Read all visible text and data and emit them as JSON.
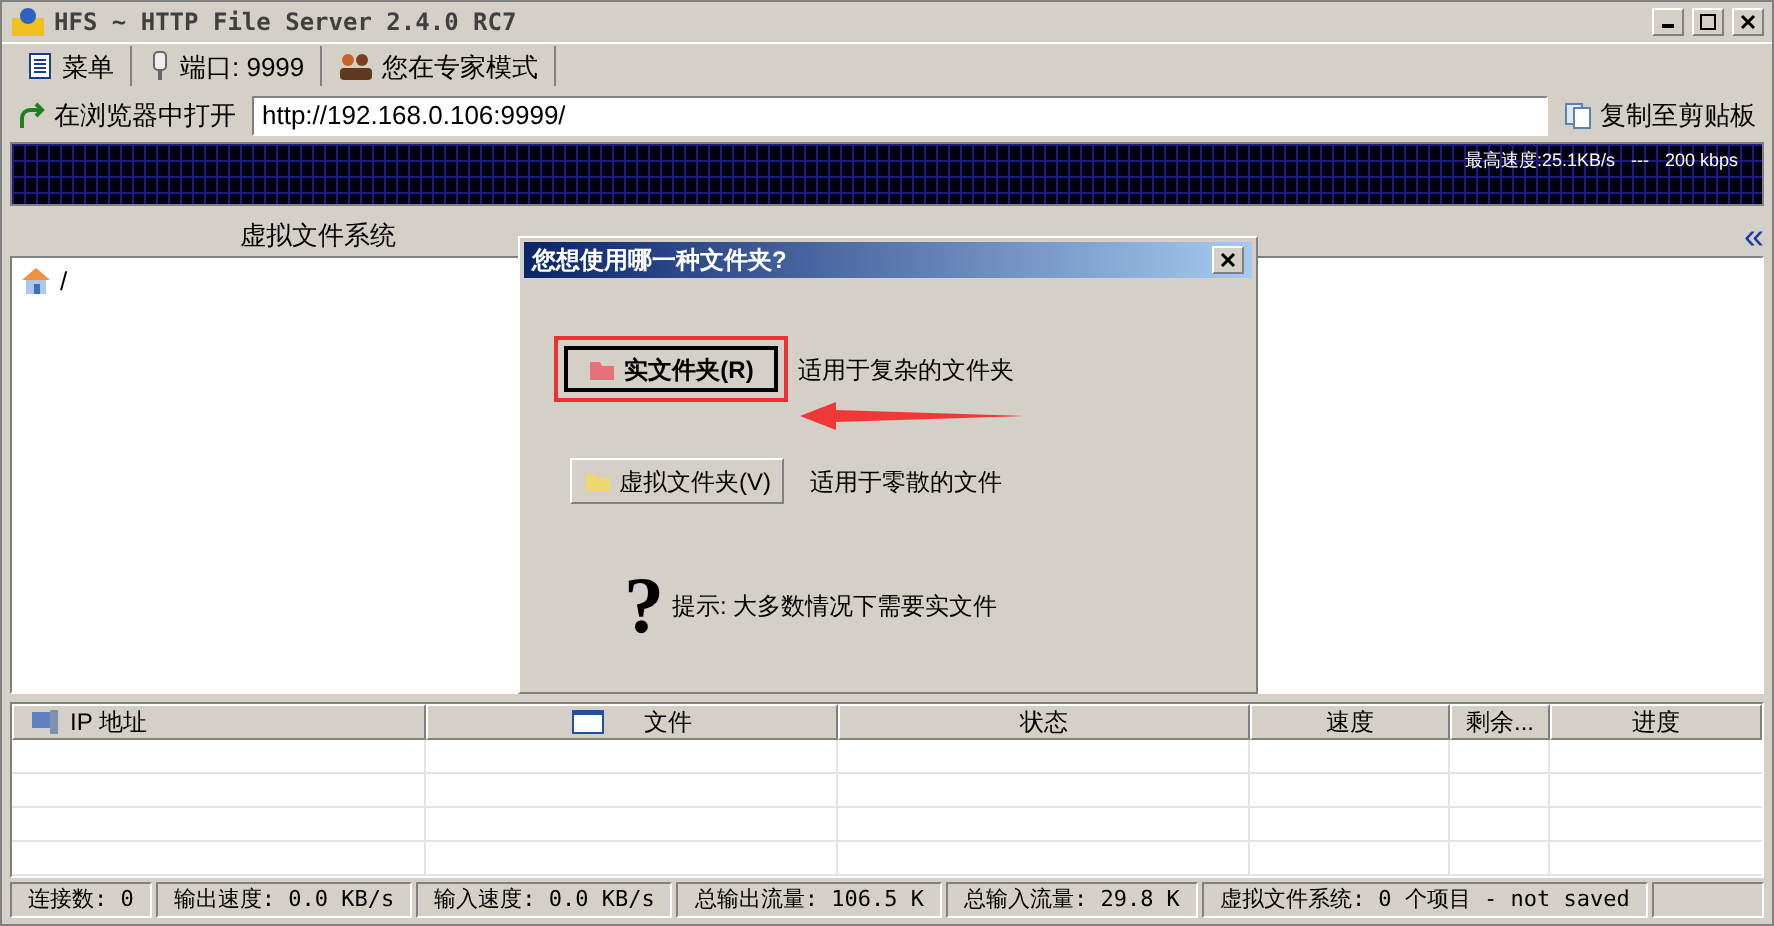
{
  "window": {
    "title": "HFS ~ HTTP File Server 2.4.0 RC7"
  },
  "toolbar": [
    {
      "kind": "menu",
      "label": "菜单"
    },
    {
      "kind": "port",
      "label": "端口: 9999"
    },
    {
      "kind": "expert",
      "label": "您在专家模式"
    }
  ],
  "url_bar": {
    "open_label": "在浏览器中打开",
    "value": "http://192.168.0.106:9999/",
    "copy_label": "复制至剪贴板"
  },
  "graph": {
    "max_speed": "最高速度:25.1KB/s",
    "separator": "---",
    "rate": "200 kbps"
  },
  "left_pane": {
    "title": "虚拟文件系统",
    "root": "/"
  },
  "collapse_button": "«",
  "dialog": {
    "title": "您想使用哪一种文件夹?",
    "options": [
      {
        "label": "实文件夹(R)",
        "description": "适用于复杂的文件夹",
        "selected": true,
        "color": "#e8707a"
      },
      {
        "label": "虚拟文件夹(V)",
        "description": "适用于零散的文件",
        "selected": false,
        "color": "#f0d870"
      }
    ],
    "hint_mark": "?",
    "hint": "提示: 大多数情况下需要实文件"
  },
  "table": {
    "columns": [
      {
        "label": "IP 地址"
      },
      {
        "label": "文件"
      },
      {
        "label": "状态"
      },
      {
        "label": "速度"
      },
      {
        "label": "剩余..."
      },
      {
        "label": "进度"
      }
    ]
  },
  "status_bar": [
    "连接数: 0",
    "输出速度: 0.0 KB/s",
    "输入速度: 0.0 KB/s",
    "总输出流量: 106.5 K",
    "总输入流量: 29.8 K",
    "虚拟文件系统: 0 个项目 - not saved"
  ]
}
